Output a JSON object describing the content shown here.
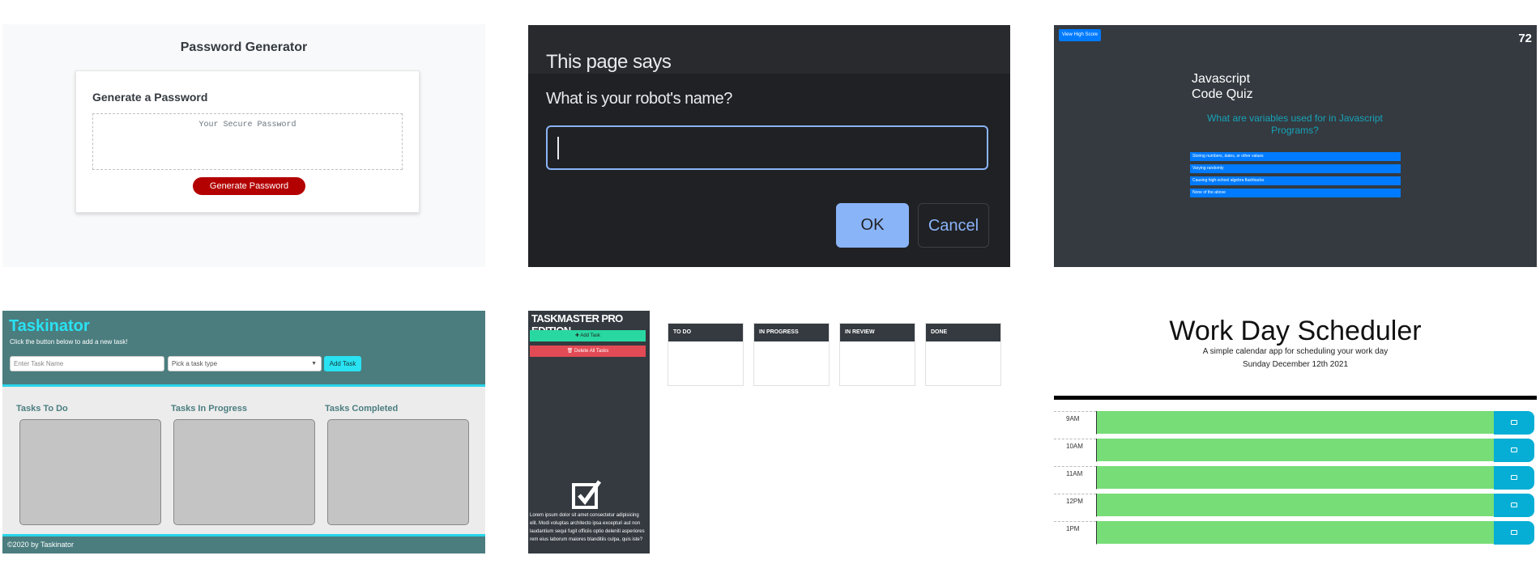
{
  "password_generator": {
    "title": "Password Generator",
    "card_heading": "Generate a Password",
    "textarea_placeholder": "Your Secure Password",
    "button_label": "Generate Password"
  },
  "prompt_dialog": {
    "title": "This page says",
    "message": "What is your robot's name?",
    "input_value": "",
    "ok_label": "OK",
    "cancel_label": "Cancel"
  },
  "code_quiz": {
    "high_score_label": "View High Score",
    "timer": "72",
    "title_line1": "Javascript",
    "title_line2": "Code Quiz",
    "question": "What are variables used for in Javascript Programs?",
    "answers": [
      "Storing numbers, dates, or other values",
      "Varying randomly",
      "Causing high-school algebra flashbacks",
      "None of the above"
    ]
  },
  "taskinator": {
    "title": "Taskinator",
    "subtitle": "Click the button below to add a new task!",
    "task_name_placeholder": "Enter Task Name",
    "task_type_placeholder": "Pick a task type",
    "add_button": "Add Task",
    "columns": [
      "Tasks To Do",
      "Tasks In Progress",
      "Tasks Completed"
    ],
    "footer": "©2020 by Taskinator"
  },
  "taskmaster": {
    "title": "TASKMASTER PRO EDITION",
    "add_button": "✚ Add Task",
    "delete_button": "🗑 Delete All Tasks",
    "description": "Lorem ipsum dolor sit amet consectetur adipisicing elit. Modi voluptas architecto ipsa excepturi aut non laudantium sequi fugit officiis optio deleniti asperiores rem eius laborum maiores blanditiis culpa, quis iste?",
    "columns": [
      "TO DO",
      "IN PROGRESS",
      "IN REVIEW",
      "DONE"
    ]
  },
  "scheduler": {
    "title": "Work Day Scheduler",
    "subtitle": "A simple calendar app for scheduling your work day",
    "date": "Sunday December 12th 2021",
    "hours": [
      "9AM",
      "10AM",
      "11AM",
      "12PM",
      "1PM"
    ],
    "slot_color": "#77dd77"
  }
}
